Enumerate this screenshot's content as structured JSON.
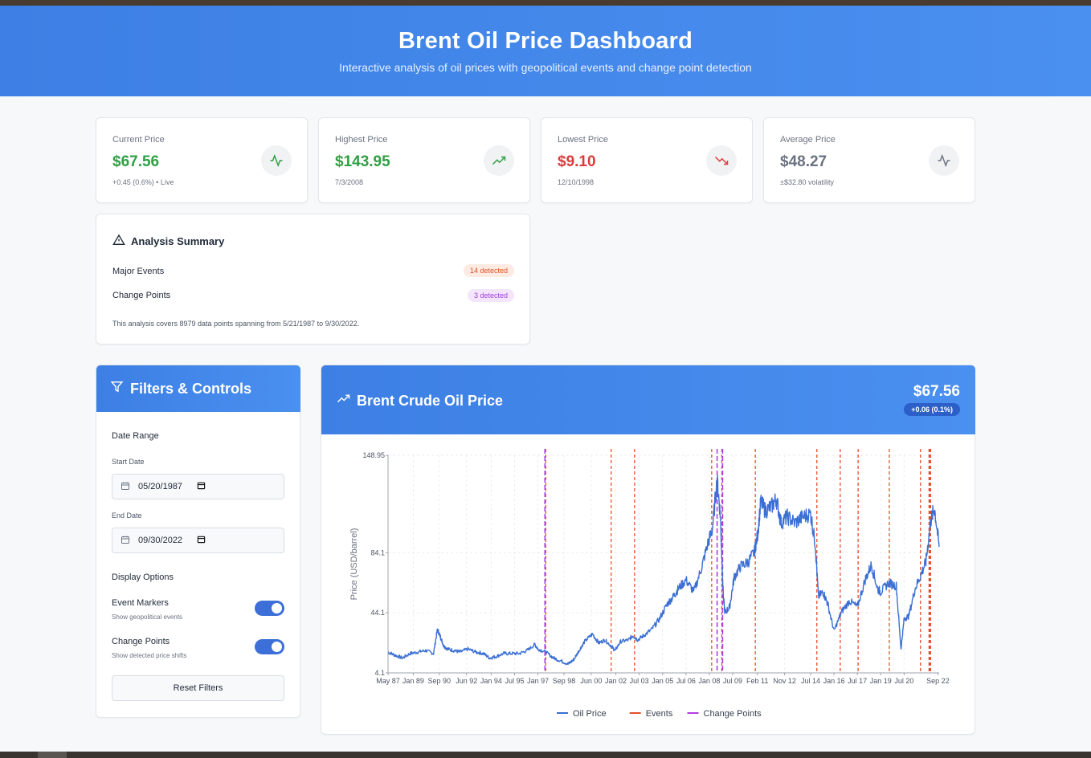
{
  "header": {
    "title": "Brent Oil Price Dashboard",
    "subtitle": "Interactive analysis of oil prices with geopolitical events and change point detection"
  },
  "stats": [
    {
      "label": "Current Price",
      "value": "$67.56",
      "sub": "+0.45 (0.6%) • Live",
      "color": "#2ea043",
      "icon": "activity-icon"
    },
    {
      "label": "Highest Price",
      "value": "$143.95",
      "sub": "7/3/2008",
      "color": "#2ea043",
      "icon": "trending-up-icon"
    },
    {
      "label": "Lowest Price",
      "value": "$9.10",
      "sub": "12/10/1998",
      "color": "#dc3b3b",
      "icon": "trending-down-icon"
    },
    {
      "label": "Average Price",
      "value": "$48.27",
      "sub": "±$32.80 volatility",
      "color": "#6b7280",
      "icon": "activity-icon"
    }
  ],
  "summary": {
    "title": "Analysis Summary",
    "rows": [
      {
        "label": "Major Events",
        "badge": "14 detected"
      },
      {
        "label": "Change Points",
        "badge": "3 detected"
      }
    ],
    "note": "This analysis covers 8979 data points spanning from 5/21/1987 to 9/30/2022."
  },
  "filters": {
    "title": "Filters & Controls",
    "date_range_label": "Date Range",
    "start_label": "Start Date",
    "start_value": "05/20/1987",
    "end_label": "End Date",
    "end_value": "09/30/2022",
    "display_label": "Display Options",
    "toggles": [
      {
        "label": "Event Markers",
        "desc": "Show geopolitical events",
        "on": true
      },
      {
        "label": "Change Points",
        "desc": "Show detected price shifts",
        "on": true
      }
    ],
    "reset_label": "Reset Filters"
  },
  "chart_panel": {
    "title": "Brent Crude Oil Price",
    "price": "$67.56",
    "change": "+0.06 (0.1%)"
  },
  "chart_data": {
    "type": "line",
    "xlabel": "",
    "ylabel": "Price (USD/barrel)",
    "ylim": [
      4.1,
      148.95
    ],
    "y_ticks": [
      "148.95",
      "84.1",
      "44.1",
      "4.1"
    ],
    "x_tick_labels": [
      "May 87",
      "Jan 89",
      "Sep 90",
      "Jun 92",
      "Jan 94",
      "Jul 95",
      "Jan 97",
      "Sep 98",
      "Jun 00",
      "Jan 02",
      "Jul 03",
      "Jan 05",
      "Jul 06",
      "Jan 08",
      "Jul 09",
      "Feb 11",
      "Nov 12",
      "Jul 14",
      "Jan 16",
      "Jul 17",
      "Jan 19",
      "Jul 20",
      "Sep 22"
    ],
    "x_tick_years": [
      1987.38,
      1989.0,
      1990.67,
      1992.42,
      1994.0,
      1995.5,
      1997.0,
      1998.67,
      2000.42,
      2002.0,
      2003.5,
      2005.0,
      2006.5,
      2008.0,
      2009.5,
      2011.08,
      2012.83,
      2014.5,
      2016.0,
      2017.5,
      2019.0,
      2020.5,
      2022.67
    ],
    "x_range": [
      1987.38,
      2022.75
    ],
    "series": [
      {
        "name": "Oil Price",
        "color": "#3b6fd4",
        "x": [
          1987.38,
          1987.8,
          1988.3,
          1988.8,
          1989.3,
          1989.8,
          1990.3,
          1990.55,
          1990.75,
          1990.95,
          1991.2,
          1991.6,
          1992.0,
          1992.5,
          1993.0,
          1993.5,
          1993.9,
          1994.3,
          1994.8,
          1995.3,
          1995.8,
          1996.3,
          1996.8,
          1997.0,
          1997.5,
          1998.0,
          1998.5,
          1998.95,
          1999.3,
          1999.7,
          2000.0,
          2000.5,
          2000.9,
          2001.3,
          2001.7,
          2001.95,
          2002.3,
          2002.8,
          2003.1,
          2003.4,
          2003.8,
          2004.3,
          2004.8,
          2005.3,
          2005.7,
          2006.0,
          2006.5,
          2007.0,
          2007.5,
          2007.9,
          2008.2,
          2008.5,
          2008.7,
          2008.9,
          2009.0,
          2009.3,
          2009.6,
          2010.0,
          2010.5,
          2010.9,
          2011.1,
          2011.3,
          2011.6,
          2012.0,
          2012.3,
          2012.6,
          2013.0,
          2013.5,
          2014.0,
          2014.5,
          2014.8,
          2015.0,
          2015.3,
          2015.6,
          2016.0,
          2016.5,
          2017.0,
          2017.5,
          2018.0,
          2018.4,
          2018.8,
          2019.0,
          2019.5,
          2020.0,
          2020.3,
          2020.5,
          2020.8,
          2021.2,
          2021.6,
          2021.9,
          2022.2,
          2022.45,
          2022.75
        ],
        "y": [
          18,
          16,
          14,
          17,
          18,
          19,
          17,
          33,
          28,
          22,
          20,
          19,
          18,
          20,
          18,
          17,
          14,
          15,
          17,
          17,
          17,
          19,
          23,
          20,
          18,
          14,
          12,
          10,
          13,
          20,
          25,
          30,
          24,
          26,
          22,
          19,
          25,
          26,
          29,
          26,
          29,
          33,
          40,
          50,
          55,
          60,
          66,
          58,
          74,
          90,
          100,
          133,
          110,
          55,
          44,
          48,
          68,
          75,
          78,
          85,
          96,
          118,
          112,
          115,
          120,
          104,
          108,
          104,
          108,
          110,
          90,
          55,
          58,
          50,
          32,
          45,
          52,
          48,
          66,
          76,
          60,
          58,
          64,
          62,
          20,
          40,
          42,
          60,
          70,
          78,
          105,
          114,
          88
        ]
      }
    ],
    "event_lines": [
      1997.5,
      2001.7,
      2003.2,
      2008.15,
      2008.8,
      2010.95,
      2014.9,
      2016.4,
      2017.55,
      2019.55,
      2021.55,
      2022.1,
      2022.15,
      2022.2
    ],
    "change_points": [
      1997.45,
      2008.5,
      2008.85
    ],
    "legend": [
      {
        "label": "Oil Price",
        "color": "#3b6fd4"
      },
      {
        "label": "Events",
        "color": "#e5512c"
      },
      {
        "label": "Change Points",
        "color": "#b23ee0"
      }
    ]
  }
}
